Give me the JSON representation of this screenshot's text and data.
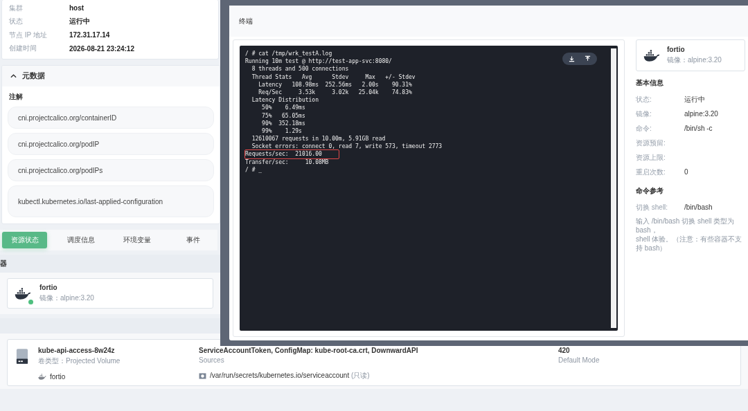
{
  "node_info": [
    {
      "label": "集群",
      "value": "host"
    },
    {
      "label": "状态",
      "value": "运行中"
    },
    {
      "label": "节点 IP 地址",
      "value": "172.31.17.14"
    },
    {
      "label": "创建时间",
      "value": "2026-08-21 23:24:12"
    }
  ],
  "metadata": {
    "title": "元数据",
    "expanded": true,
    "annotations_title": "注解",
    "annotations": [
      "cni.projectcalico.org/containerID",
      "cni.projectcalico.org/podIP",
      "cni.projectcalico.org/podIPs",
      "kubectl.kubernetes.io/last-applied-configuration"
    ]
  },
  "tabs": [
    {
      "label": "资源状态",
      "selected": true
    },
    {
      "label": "调度信息",
      "selected": false
    },
    {
      "label": "环境变量",
      "selected": false
    },
    {
      "label": "事件",
      "selected": false
    }
  ],
  "containers_section": {
    "title": "器"
  },
  "container": {
    "name": "fortio",
    "image": "镜像：alpine:3.20",
    "running": true
  },
  "volume": {
    "name": "kube-api-access-8w24z",
    "type": "卷类型：Projected Volume",
    "sources": "ServiceAccountToken, ConfigMap: kube-root-ca.crt, DownwardAPI",
    "sources_label": "Sources",
    "container": "fortio",
    "mount": "/var/run/secrets/kubernetes.io/serviceaccount",
    "mount_note": "(只读)",
    "mode": "420",
    "mode_label": "Default Mode"
  },
  "terminal_dialog": {
    "title": "终端",
    "lines": [
      {
        "text": "/ # cat /tmp/wrk_testA.log",
        "highlighted": false
      },
      {
        "text": "Running 10m test @ http://test-app-svc:8080/",
        "highlighted": false
      },
      {
        "text": "  8 threads and 500 connections",
        "highlighted": false
      },
      {
        "text": "  Thread Stats   Avg      Stdev     Max   +/- Stdev",
        "highlighted": false
      },
      {
        "text": "    Latency   108.98ms  252.56ms   2.00s    90.31%",
        "highlighted": false
      },
      {
        "text": "    Req/Sec     3.53k     3.02k   25.04k    74.83%",
        "highlighted": false
      },
      {
        "text": "  Latency Distribution",
        "highlighted": false
      },
      {
        "text": "     50%    6.49ms",
        "highlighted": false
      },
      {
        "text": "     75%   65.05ms",
        "highlighted": false
      },
      {
        "text": "     90%  352.18ms",
        "highlighted": false
      },
      {
        "text": "     99%    1.29s",
        "highlighted": false
      },
      {
        "text": "  12610067 requests in 10.00m, 5.91GB read",
        "highlighted": false
      },
      {
        "text": "  Socket errors: connect 0, read 7, write 573, timeout 2773",
        "highlighted": false
      },
      {
        "text": "Requests/sec:  21016.00",
        "highlighted": true
      },
      {
        "text": "Transfer/sec:     10.08MB",
        "highlighted": false
      },
      {
        "text": "/ # _",
        "highlighted": false
      }
    ],
    "container": {
      "name": "fortio",
      "image": "镜像：alpine:3.20"
    },
    "basic_info_title": "基本信息",
    "basic_info": [
      {
        "label": "状态:",
        "value": "运行中"
      },
      {
        "label": "镜像:",
        "value": "alpine:3.20"
      },
      {
        "label": "命令:",
        "value": "/bin/sh -c"
      },
      {
        "label": "资源预留:"
      },
      {
        "label": "资源上限:"
      },
      {
        "label": "重启次数:",
        "value": "0"
      }
    ],
    "command_ref_title": "命令参考",
    "shell_label": "切换 shell:",
    "shell_value": "/bin/bash",
    "hint_lines": [
      "输入 /bin/bash 切换 shell 类型为 bash，",
      "shell 体验。（注意：有些容器不支持 bash）"
    ]
  }
}
